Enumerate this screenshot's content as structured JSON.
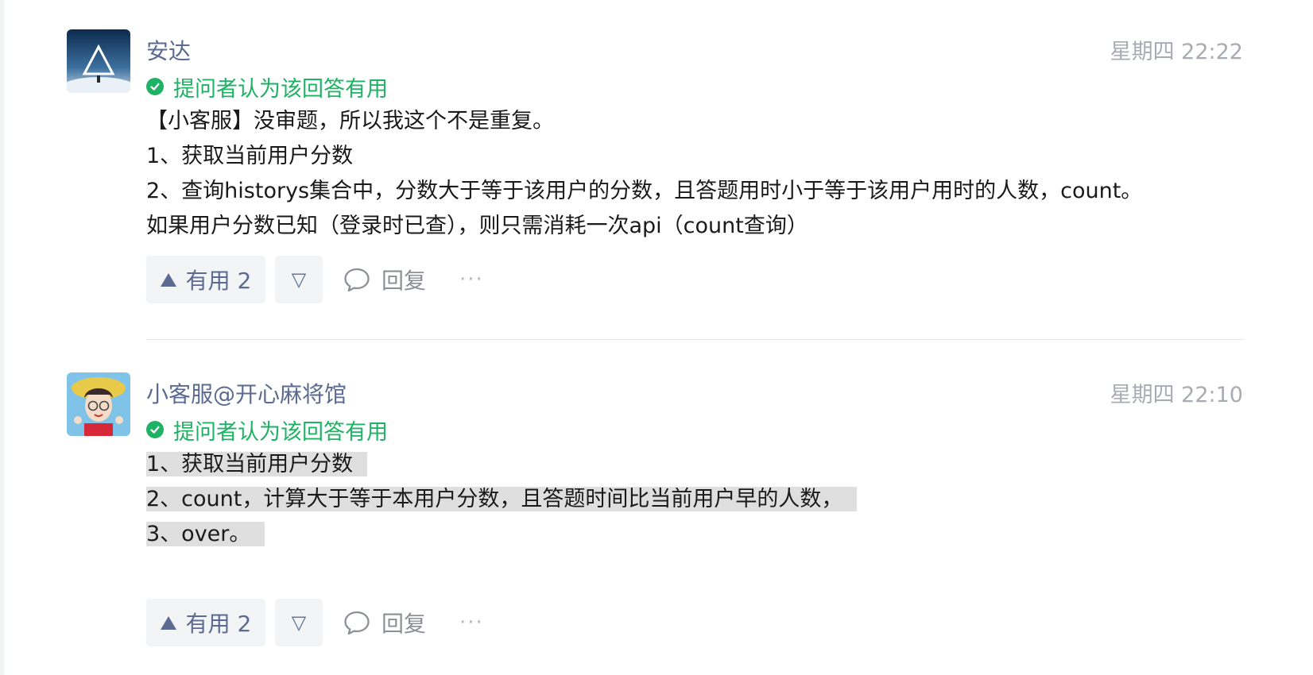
{
  "answers": [
    {
      "author": "安达",
      "time": "星期四 22:22",
      "accepted_label": "提问者认为该回答有用",
      "lines": [
        "【小客服】没审题，所以我这个不是重复。",
        "1、获取当前用户分数",
        "2、查询historys集合中，分数大于等于该用户的分数，且答题用时小于等于该用户用时的人数，count。",
        "如果用户分数已知（登录时已查），则只需消耗一次api（count查询）"
      ],
      "upvote_label": "有用 2",
      "downvote_icon": "▽",
      "reply_label": "回复",
      "more_label": "···"
    },
    {
      "author": "小客服@开心麻将馆",
      "time": "星期四 22:10",
      "accepted_label": "提问者认为该回答有用",
      "lines": [
        "1、获取当前用户分数",
        "2、count，计算大于等于本用户分数，且答题时间比当前用户早的人数，",
        "3、over。"
      ],
      "upvote_label": "有用 2",
      "downvote_icon": "▽",
      "reply_label": "回复",
      "more_label": "···"
    }
  ],
  "colors": {
    "accent": "#5b6a91",
    "accepted": "#1eb264",
    "meta": "#a8abb3",
    "selection": "#dfdfdf"
  }
}
